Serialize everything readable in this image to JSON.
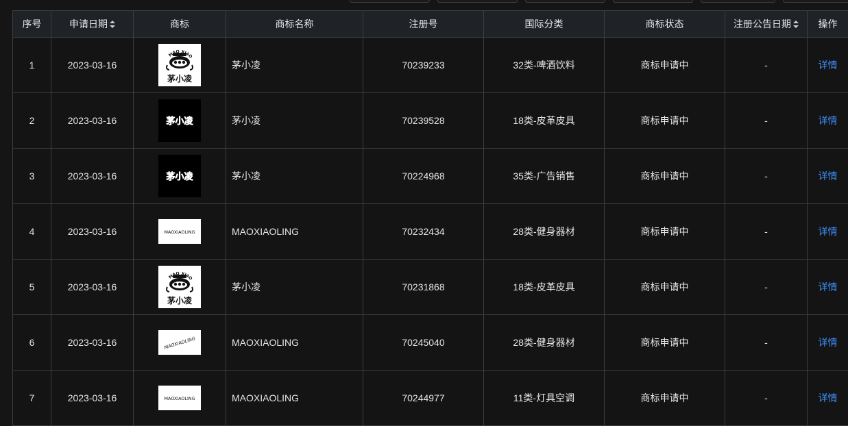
{
  "table": {
    "headers": {
      "index": "序号",
      "apply_date": "申请日期",
      "logo": "商标",
      "name": "商标名称",
      "reg_no": "注册号",
      "category": "国际分类",
      "status": "商标状态",
      "announce_date": "注册公告日期",
      "action": "操作"
    },
    "rows": [
      {
        "index": "1",
        "apply_date": "2023-03-16",
        "logo_type": "mascot-logo",
        "name": "茅小凌",
        "reg_no": "70239233",
        "category": "32类-啤酒饮料",
        "status": "商标申请中",
        "announce_date": "-",
        "action": "详情"
      },
      {
        "index": "2",
        "apply_date": "2023-03-16",
        "logo_type": "black-text-logo",
        "name": "茅小凌",
        "reg_no": "70239528",
        "category": "18类-皮革皮具",
        "status": "商标申请中",
        "announce_date": "-",
        "action": "详情"
      },
      {
        "index": "3",
        "apply_date": "2023-03-16",
        "logo_type": "black-text-logo",
        "name": "茅小凌",
        "reg_no": "70224968",
        "category": "35类-广告销售",
        "status": "商标申请中",
        "announce_date": "-",
        "action": "详情"
      },
      {
        "index": "4",
        "apply_date": "2023-03-16",
        "logo_type": "wordmark-logo",
        "name": "MAOXIAOLING",
        "reg_no": "70232434",
        "category": "28类-健身器材",
        "status": "商标申请中",
        "announce_date": "-",
        "action": "详情"
      },
      {
        "index": "5",
        "apply_date": "2023-03-16",
        "logo_type": "mascot-logo",
        "name": "茅小凌",
        "reg_no": "70231868",
        "category": "18类-皮革皮具",
        "status": "商标申请中",
        "announce_date": "-",
        "action": "详情"
      },
      {
        "index": "6",
        "apply_date": "2023-03-16",
        "logo_type": "slanted-wordmark-logo",
        "name": "MAOXIAOLING",
        "reg_no": "70245040",
        "category": "28类-健身器材",
        "status": "商标申请中",
        "announce_date": "-",
        "action": "详情"
      },
      {
        "index": "7",
        "apply_date": "2023-03-16",
        "logo_type": "wordmark-logo",
        "name": "MAOXIAOLING",
        "reg_no": "70244977",
        "category": "11类-灯具空调",
        "status": "商标申请中",
        "announce_date": "-",
        "action": "详情"
      }
    ]
  },
  "logos": {
    "mascot_text": "茅小凌",
    "mascot_arc_text": "MAO XIAO LING",
    "black_text": "茅小凌",
    "wordmark_text": "MAOXIAOLING"
  },
  "colors": {
    "link": "#3d8ef7",
    "header_bg": "#1f2327",
    "row_bg": "#141414",
    "border": "#3e3e3e"
  },
  "icons": {
    "sort": "sort-icon"
  }
}
